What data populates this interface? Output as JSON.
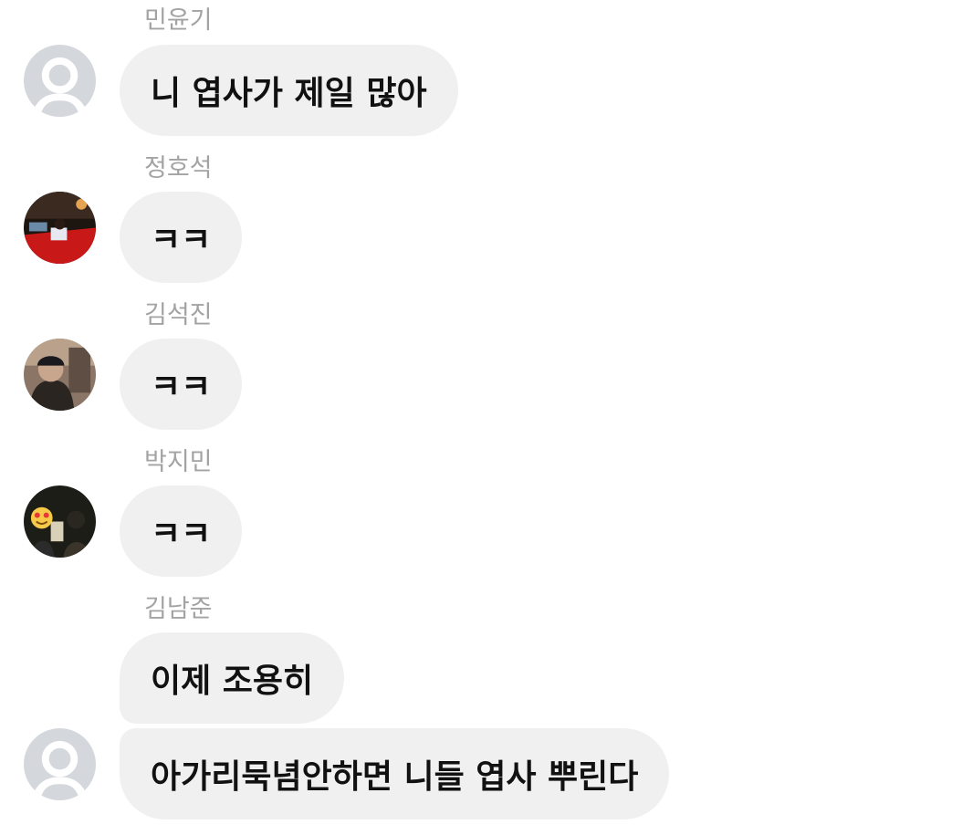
{
  "messages": [
    {
      "sender": "민윤기",
      "text": "니 엽사가 제일 많아",
      "avatar": "default-avatar-icon"
    },
    {
      "sender": "정호석",
      "text": "ㅋㅋ",
      "avatar": "photo-avatar-car"
    },
    {
      "sender": "김석진",
      "text": "ㅋㅋ",
      "avatar": "photo-avatar-cap"
    },
    {
      "sender": "박지민",
      "text": "ㅋㅋ",
      "avatar": "photo-avatar-emoji"
    },
    {
      "sender": "김남준",
      "text": "이제 조용히"
    },
    {
      "text": "아가리묵념안하면 니들 엽사 뿌린다",
      "avatar": "default-avatar-icon"
    }
  ],
  "colors": {
    "bubble": "#f0f0f0",
    "sender_name": "#a3a3a3",
    "text": "#111111",
    "default_avatar": "#d4d7dc"
  }
}
